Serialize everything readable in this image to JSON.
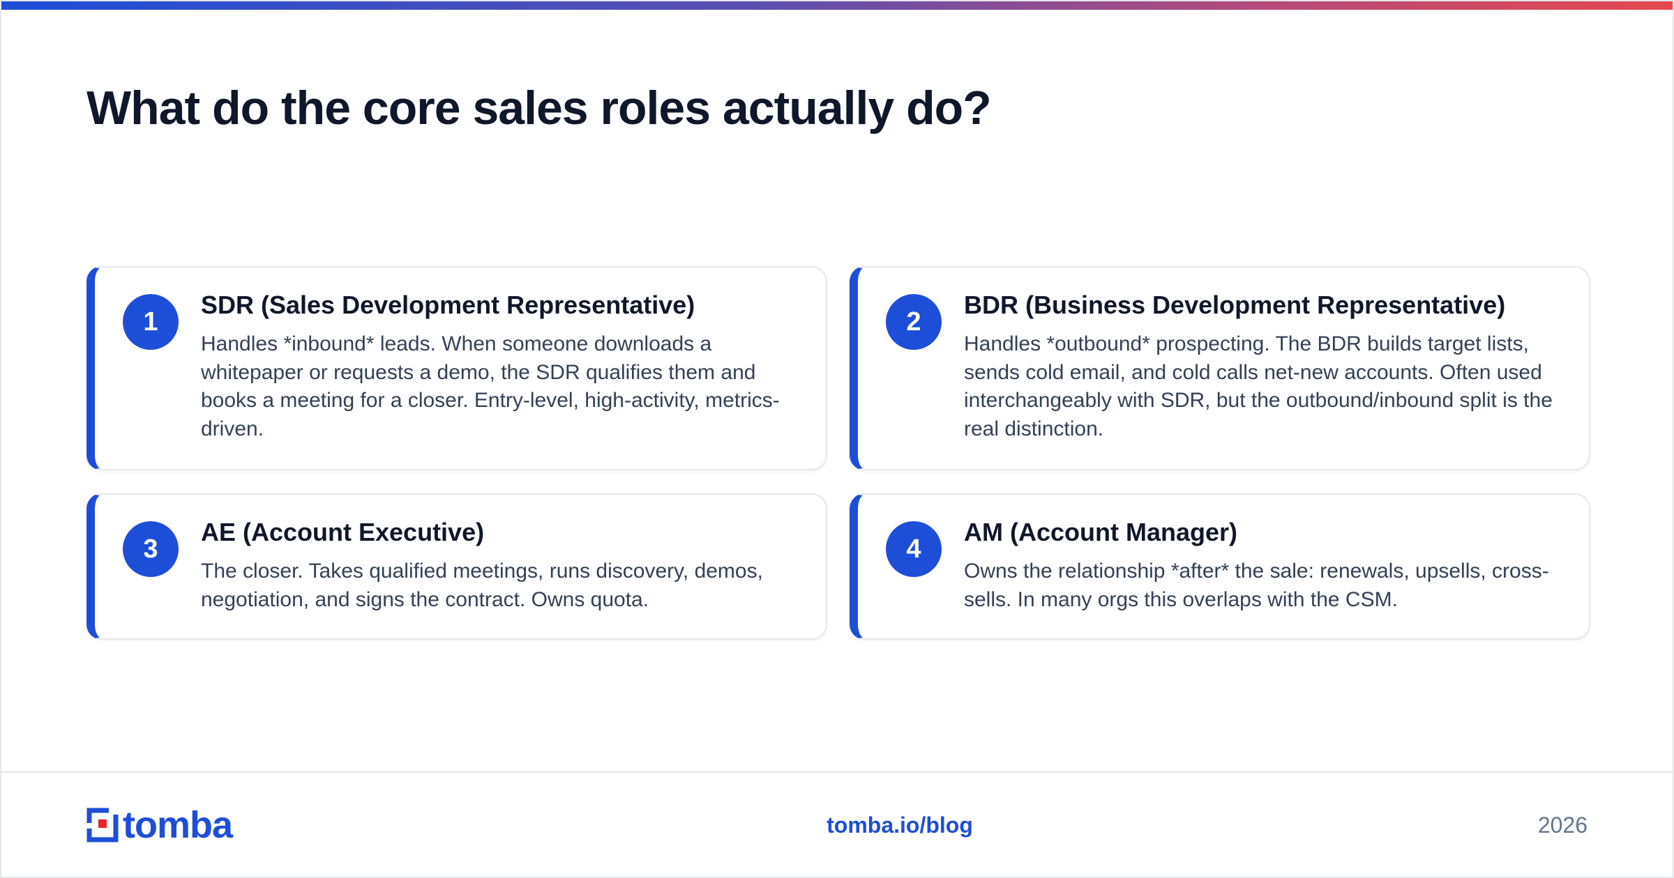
{
  "title": "What do the core sales roles actually do?",
  "colors": {
    "accent": "#1d4ed8",
    "title_text": "#0f172a",
    "body_text": "#334155",
    "muted_text": "#64748b",
    "card_border": "#e5e7eb",
    "logo_red": "#e5242a"
  },
  "roles": [
    {
      "number": "1",
      "title": "SDR (Sales Development Representative)",
      "description": "Handles *inbound* leads. When someone downloads a whitepaper or requests a demo, the SDR qualifies them and books a meeting for a closer. Entry-level, high-activity, metrics-driven."
    },
    {
      "number": "2",
      "title": "BDR (Business Development Representative)",
      "description": "Handles *outbound* prospecting. The BDR builds target lists, sends cold email, and cold calls net-new accounts. Often used interchangeably with SDR, but the outbound/inbound split is the real distinction."
    },
    {
      "number": "3",
      "title": "AE (Account Executive)",
      "description": "The closer. Takes qualified meetings, runs discovery, demos, negotiation, and signs the contract. Owns quota."
    },
    {
      "number": "4",
      "title": "AM (Account Manager)",
      "description": "Owns the relationship *after* the sale: renewals, upsells, cross-sells. In many orgs this overlaps with the CSM."
    }
  ],
  "footer": {
    "logo_text": "tomba",
    "link": "tomba.io/blog",
    "year": "2026"
  }
}
